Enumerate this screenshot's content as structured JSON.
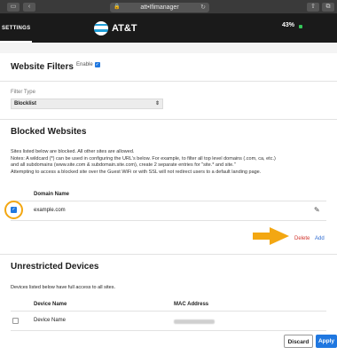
{
  "browser": {
    "address": "att•Ifimanager"
  },
  "app": {
    "settings_tab": "SETTINGS",
    "brand": "AT&T",
    "battery": "43%"
  },
  "website_filters": {
    "title": "Website Filters",
    "enable_label": "Enable",
    "enable_checked": true,
    "filter_type_label": "Filter Type",
    "filter_type_value": "Blocklist"
  },
  "blocked_websites": {
    "title": "Blocked Websites",
    "notes": [
      "Sites listed below are blocked. All other sites are allowed.",
      "Notes: A wildcard (*) can be used in configuring the URL's below. For example, to filter all top level domains (.com, ca, etc.)",
      "and all subdomains (www.site.com & subdomain.site.com), create 2 separate entries for \"site.* and site.\"",
      "Attempting to access a blocked site over the Guest WiFi or with SSL will not redirect users to a default landing page."
    ],
    "column_header": "Domain Name",
    "rows": [
      {
        "domain": "example.com",
        "checked": true
      }
    ],
    "delete_label": "Delete",
    "add_label": "Add"
  },
  "unrestricted_devices": {
    "title": "Unrestricted Devices",
    "description": "Devices listed below have full access to all sites.",
    "columns": [
      "Device Name",
      "MAC Address"
    ],
    "rows": [
      {
        "device_name": "Device Name",
        "checked": false
      }
    ]
  },
  "footer": {
    "discard_label": "Discard",
    "apply_label": "Apply"
  },
  "colors": {
    "accent": "#1f77e0",
    "highlight": "#f3a712",
    "delete": "#d2342c",
    "header": "#1a1a1a"
  }
}
